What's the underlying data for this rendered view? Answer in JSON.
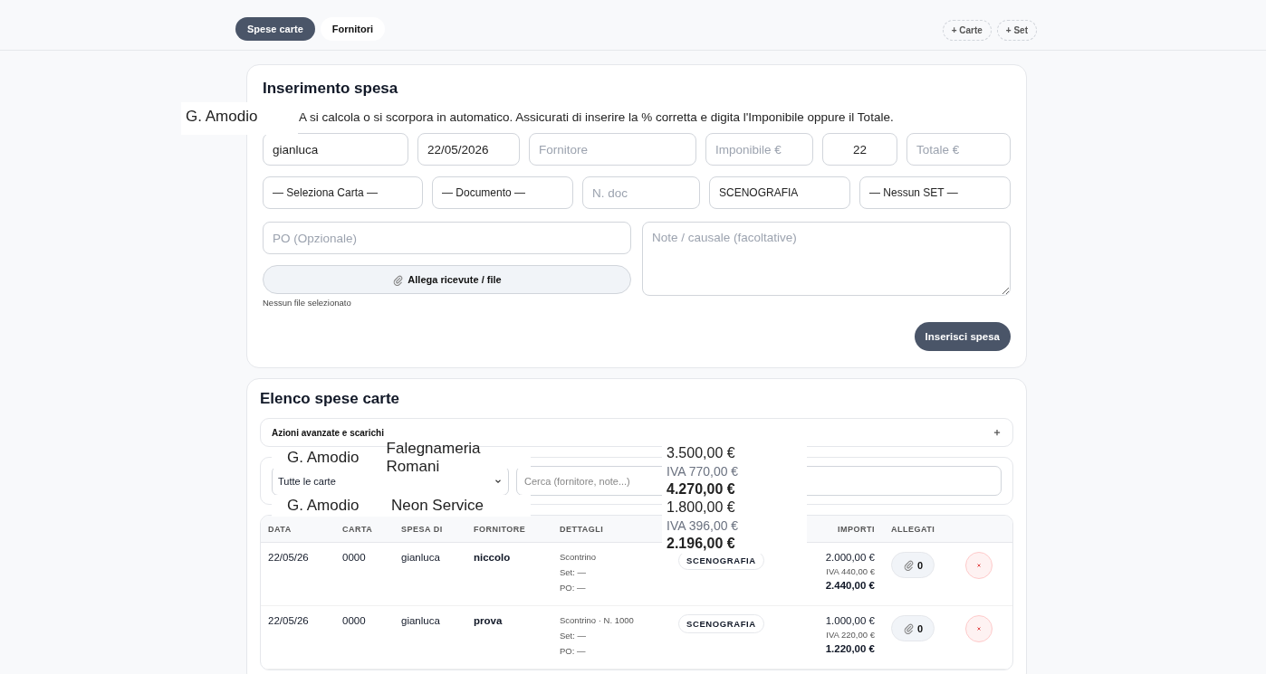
{
  "tabs": [
    {
      "label": "Spese carte",
      "selected": true
    },
    {
      "label": "Fornitori",
      "selected": false
    }
  ],
  "top_actions": [
    "+ Carte",
    "+ Set"
  ],
  "entry_form": {
    "title": "Inserimento spesa",
    "hint": "A si calcola o si scorpora in automatico. Assicurati di inserire la % corretta e digita l'Imponibile oppure il Totale.",
    "row_1": [
      {
        "kind": "input",
        "value": "gianluca"
      },
      {
        "kind": "input",
        "value": "22/05/2026"
      },
      {
        "kind": "input",
        "placeholder": "Fornitore"
      },
      {
        "kind": "input",
        "placeholder": "Imponibile €"
      },
      {
        "kind": "number",
        "value": "22"
      },
      {
        "kind": "input",
        "placeholder": "Totale €"
      }
    ],
    "row_2": [
      {
        "kind": "select",
        "value": "— Seleziona Carta —"
      },
      {
        "kind": "select",
        "value": "— Documento —"
      },
      {
        "kind": "input",
        "placeholder": "N. doc"
      },
      {
        "kind": "select",
        "value": "SCENOGRAFIA"
      },
      {
        "kind": "select",
        "value": "— Nessun SET —"
      }
    ],
    "po_field": {
      "placeholder": "PO (Opzionale)"
    },
    "attach_button": "Allega ricevute / file",
    "file_status": "Nessun file selezionato",
    "notes_field": {
      "placeholder": "Note / causale (facoltative)"
    },
    "submit_button": "Inserisci spesa"
  },
  "list": {
    "title": "Elenco spese carte",
    "advanced_actions": {
      "label": "Azioni avanzate e scarichi",
      "expanded": false
    },
    "filter": {
      "value": "Tutte le carte"
    },
    "search": {
      "placeholder": "Cerca (fornitore, note...)"
    },
    "table": {
      "columns": [
        "DATA",
        "CARTA",
        "SPESA DI",
        "FORNITORE",
        "DETTAGLI",
        "IMPORTI",
        "ALLEGATI"
      ],
      "rows": [
        {
          "date": "22/05/26",
          "card": "0000",
          "spent_by": "gianluca",
          "supplier": "niccolo",
          "document": "Scontrino",
          "set": "Set: —",
          "po": "PO: —",
          "category": "SCENOGRAFIA",
          "net": "2.000,00 €",
          "vat": "IVA 440,00 €",
          "total": "2.440,00 €",
          "attachments": "0"
        },
        {
          "date": "22/05/26",
          "card": "0000",
          "spent_by": "gianluca",
          "supplier": "prova",
          "document": "Scontrino · N. 1000",
          "set": "Set: —",
          "po": "PO: —",
          "category": "SCENOGRAFIA",
          "net": "1.000,00 €",
          "vat": "IVA 220,00 €",
          "total": "1.220,00 €",
          "attachments": "0"
        }
      ]
    }
  },
  "floating_labels": {
    "top_name": "G. Amodio",
    "rows": [
      {
        "name": "G. Amodio",
        "supplier": "Falegnameria Romani"
      },
      {
        "name": "G. Amodio",
        "supplier": "Neon Service"
      }
    ],
    "amounts": [
      {
        "net": "3.500,00 €",
        "vat": "IVA 770,00 €",
        "total": "4.270,00 €"
      },
      {
        "net": "1.800,00 €",
        "vat": "IVA 396,00 €",
        "total": "2.196,00 €"
      }
    ]
  }
}
